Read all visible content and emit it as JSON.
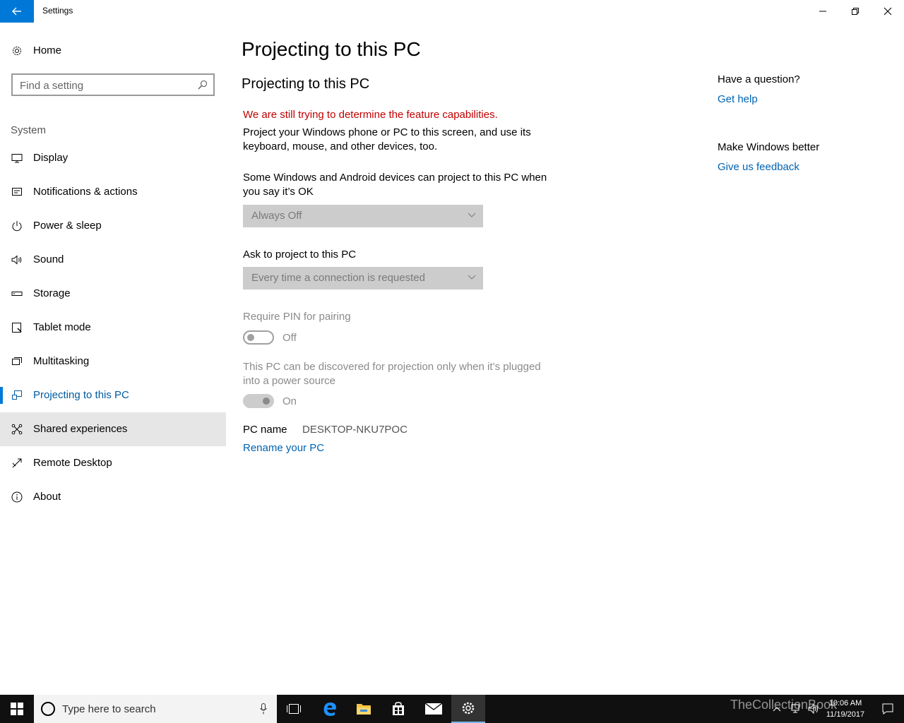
{
  "window": {
    "title": "Settings"
  },
  "sidebar": {
    "home_label": "Home",
    "search_placeholder": "Find a setting",
    "section_label": "System",
    "items": [
      {
        "label": "Display",
        "icon": "monitor-icon"
      },
      {
        "label": "Notifications & actions",
        "icon": "notifications-icon"
      },
      {
        "label": "Power & sleep",
        "icon": "power-icon"
      },
      {
        "label": "Sound",
        "icon": "speaker-icon"
      },
      {
        "label": "Storage",
        "icon": "storage-icon"
      },
      {
        "label": "Tablet mode",
        "icon": "tablet-icon"
      },
      {
        "label": "Multitasking",
        "icon": "multitasking-icon"
      },
      {
        "label": "Projecting to this PC",
        "icon": "projecting-icon",
        "active": true
      },
      {
        "label": "Shared experiences",
        "icon": "shared-experiences-icon",
        "hover": true
      },
      {
        "label": "Remote Desktop",
        "icon": "remote-desktop-icon"
      },
      {
        "label": "About",
        "icon": "info-icon"
      }
    ]
  },
  "main": {
    "page_title": "Projecting to this PC",
    "section_title": "Projecting to this PC",
    "warning": "We are still trying to determine the feature capabilities.",
    "description": "Project your Windows phone or PC to this screen, and use its keyboard, mouse, and other devices, too.",
    "allow_label": "Some Windows and Android devices can project to this PC when you say it’s OK",
    "allow_value": "Always Off",
    "ask_label": "Ask to project to this PC",
    "ask_value": "Every time a connection is requested",
    "pin_label": "Require PIN for pairing",
    "pin_state": "Off",
    "power_label": "This PC can be discovered for projection only when it’s plugged into a power source",
    "power_state": "On",
    "pc_name_label": "PC name",
    "pc_name_value": "DESKTOP-NKU7POC",
    "rename_link": "Rename your PC"
  },
  "right_panel": {
    "question_heading": "Have a question?",
    "get_help": "Get help",
    "feedback_heading": "Make Windows better",
    "give_feedback": "Give us feedback"
  },
  "taskbar": {
    "search_placeholder": "Type here to search",
    "time": "10:06 AM",
    "date": "11/19/2017",
    "watermark": "TheCollectionBook"
  },
  "colors": {
    "accent": "#0078d7",
    "link": "#0063b1",
    "warning": "#c00000"
  }
}
